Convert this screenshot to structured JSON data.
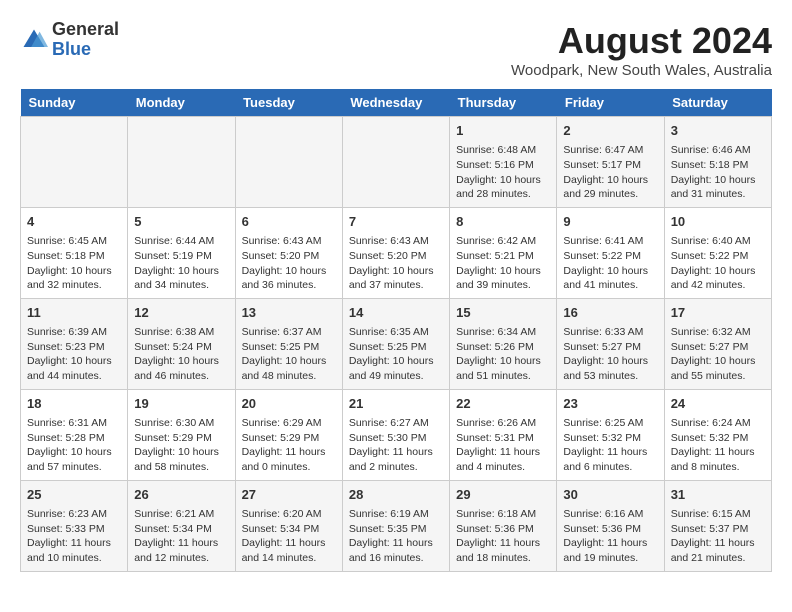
{
  "header": {
    "logo_line1": "General",
    "logo_line2": "Blue",
    "month_year": "August 2024",
    "location": "Woodpark, New South Wales, Australia"
  },
  "days_of_week": [
    "Sunday",
    "Monday",
    "Tuesday",
    "Wednesday",
    "Thursday",
    "Friday",
    "Saturday"
  ],
  "weeks": [
    [
      {
        "day": "",
        "content": ""
      },
      {
        "day": "",
        "content": ""
      },
      {
        "day": "",
        "content": ""
      },
      {
        "day": "",
        "content": ""
      },
      {
        "day": "1",
        "content": "Sunrise: 6:48 AM\nSunset: 5:16 PM\nDaylight: 10 hours and 28 minutes."
      },
      {
        "day": "2",
        "content": "Sunrise: 6:47 AM\nSunset: 5:17 PM\nDaylight: 10 hours and 29 minutes."
      },
      {
        "day": "3",
        "content": "Sunrise: 6:46 AM\nSunset: 5:18 PM\nDaylight: 10 hours and 31 minutes."
      }
    ],
    [
      {
        "day": "4",
        "content": "Sunrise: 6:45 AM\nSunset: 5:18 PM\nDaylight: 10 hours and 32 minutes."
      },
      {
        "day": "5",
        "content": "Sunrise: 6:44 AM\nSunset: 5:19 PM\nDaylight: 10 hours and 34 minutes."
      },
      {
        "day": "6",
        "content": "Sunrise: 6:43 AM\nSunset: 5:20 PM\nDaylight: 10 hours and 36 minutes."
      },
      {
        "day": "7",
        "content": "Sunrise: 6:43 AM\nSunset: 5:20 PM\nDaylight: 10 hours and 37 minutes."
      },
      {
        "day": "8",
        "content": "Sunrise: 6:42 AM\nSunset: 5:21 PM\nDaylight: 10 hours and 39 minutes."
      },
      {
        "day": "9",
        "content": "Sunrise: 6:41 AM\nSunset: 5:22 PM\nDaylight: 10 hours and 41 minutes."
      },
      {
        "day": "10",
        "content": "Sunrise: 6:40 AM\nSunset: 5:22 PM\nDaylight: 10 hours and 42 minutes."
      }
    ],
    [
      {
        "day": "11",
        "content": "Sunrise: 6:39 AM\nSunset: 5:23 PM\nDaylight: 10 hours and 44 minutes."
      },
      {
        "day": "12",
        "content": "Sunrise: 6:38 AM\nSunset: 5:24 PM\nDaylight: 10 hours and 46 minutes."
      },
      {
        "day": "13",
        "content": "Sunrise: 6:37 AM\nSunset: 5:25 PM\nDaylight: 10 hours and 48 minutes."
      },
      {
        "day": "14",
        "content": "Sunrise: 6:35 AM\nSunset: 5:25 PM\nDaylight: 10 hours and 49 minutes."
      },
      {
        "day": "15",
        "content": "Sunrise: 6:34 AM\nSunset: 5:26 PM\nDaylight: 10 hours and 51 minutes."
      },
      {
        "day": "16",
        "content": "Sunrise: 6:33 AM\nSunset: 5:27 PM\nDaylight: 10 hours and 53 minutes."
      },
      {
        "day": "17",
        "content": "Sunrise: 6:32 AM\nSunset: 5:27 PM\nDaylight: 10 hours and 55 minutes."
      }
    ],
    [
      {
        "day": "18",
        "content": "Sunrise: 6:31 AM\nSunset: 5:28 PM\nDaylight: 10 hours and 57 minutes."
      },
      {
        "day": "19",
        "content": "Sunrise: 6:30 AM\nSunset: 5:29 PM\nDaylight: 10 hours and 58 minutes."
      },
      {
        "day": "20",
        "content": "Sunrise: 6:29 AM\nSunset: 5:29 PM\nDaylight: 11 hours and 0 minutes."
      },
      {
        "day": "21",
        "content": "Sunrise: 6:27 AM\nSunset: 5:30 PM\nDaylight: 11 hours and 2 minutes."
      },
      {
        "day": "22",
        "content": "Sunrise: 6:26 AM\nSunset: 5:31 PM\nDaylight: 11 hours and 4 minutes."
      },
      {
        "day": "23",
        "content": "Sunrise: 6:25 AM\nSunset: 5:32 PM\nDaylight: 11 hours and 6 minutes."
      },
      {
        "day": "24",
        "content": "Sunrise: 6:24 AM\nSunset: 5:32 PM\nDaylight: 11 hours and 8 minutes."
      }
    ],
    [
      {
        "day": "25",
        "content": "Sunrise: 6:23 AM\nSunset: 5:33 PM\nDaylight: 11 hours and 10 minutes."
      },
      {
        "day": "26",
        "content": "Sunrise: 6:21 AM\nSunset: 5:34 PM\nDaylight: 11 hours and 12 minutes."
      },
      {
        "day": "27",
        "content": "Sunrise: 6:20 AM\nSunset: 5:34 PM\nDaylight: 11 hours and 14 minutes."
      },
      {
        "day": "28",
        "content": "Sunrise: 6:19 AM\nSunset: 5:35 PM\nDaylight: 11 hours and 16 minutes."
      },
      {
        "day": "29",
        "content": "Sunrise: 6:18 AM\nSunset: 5:36 PM\nDaylight: 11 hours and 18 minutes."
      },
      {
        "day": "30",
        "content": "Sunrise: 6:16 AM\nSunset: 5:36 PM\nDaylight: 11 hours and 19 minutes."
      },
      {
        "day": "31",
        "content": "Sunrise: 6:15 AM\nSunset: 5:37 PM\nDaylight: 11 hours and 21 minutes."
      }
    ]
  ]
}
